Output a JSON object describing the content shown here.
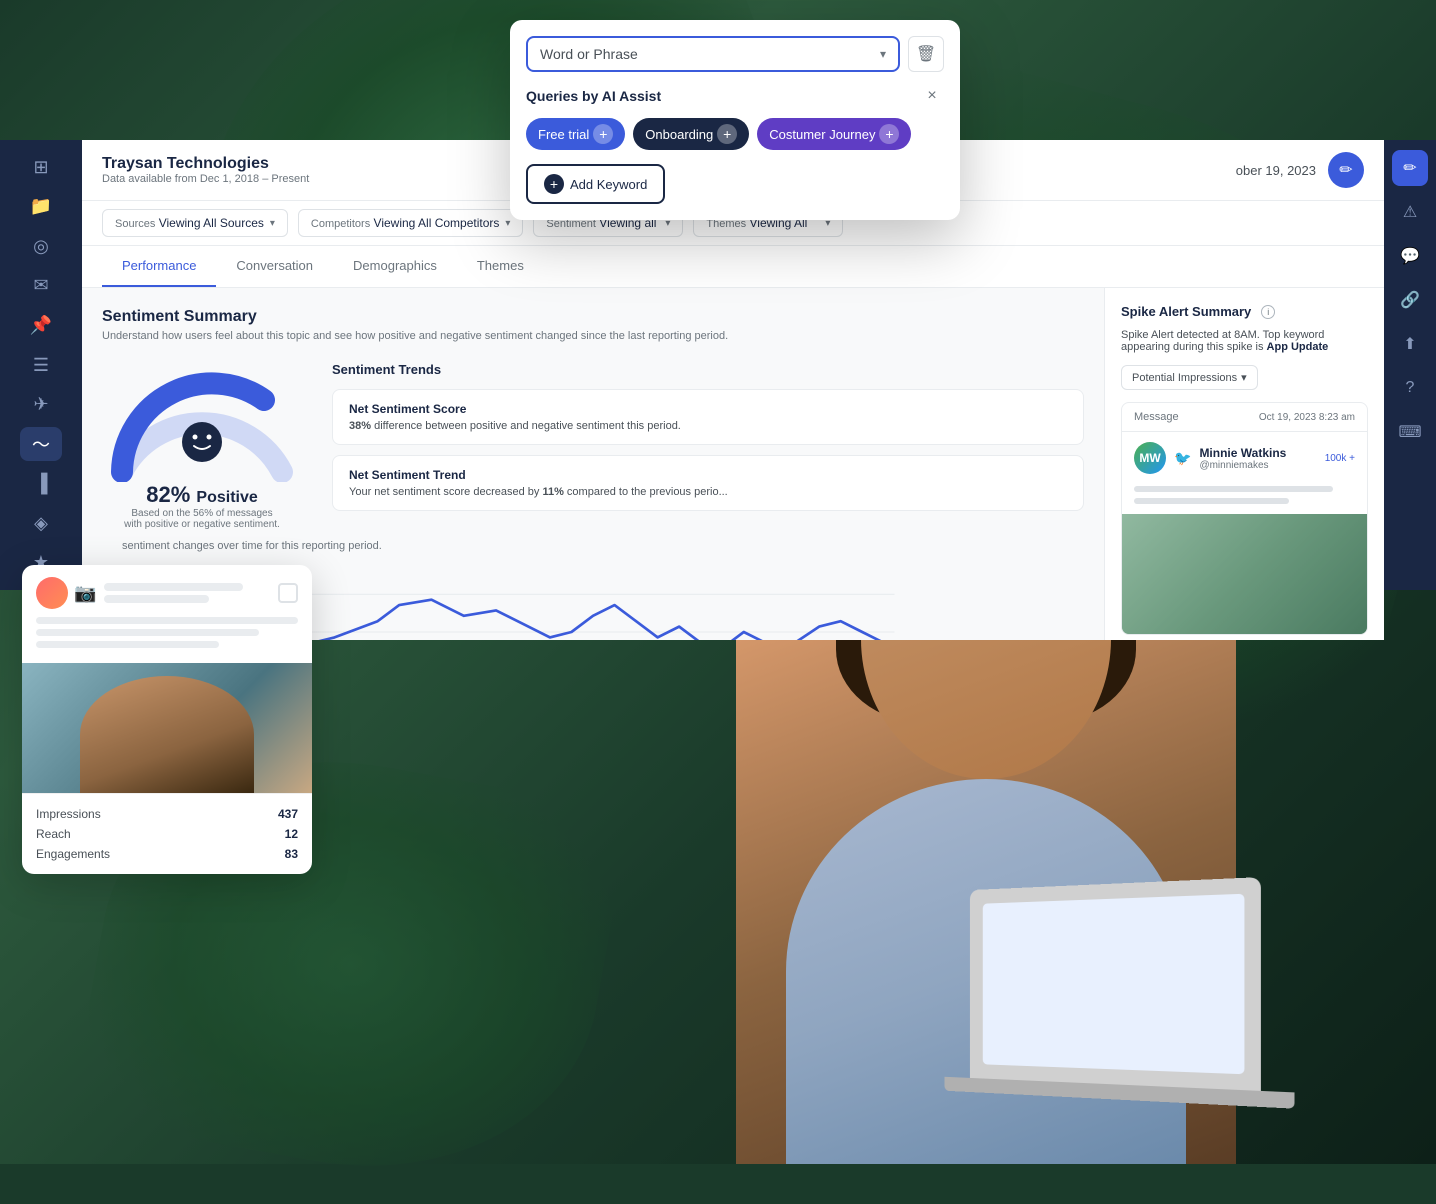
{
  "background": {
    "color": "#1a3a2a"
  },
  "sidebar": {
    "icons": [
      {
        "name": "home-icon",
        "symbol": "⊞",
        "active": false
      },
      {
        "name": "file-icon",
        "symbol": "📁",
        "active": false
      },
      {
        "name": "analytics-icon",
        "symbol": "◎",
        "active": false
      },
      {
        "name": "mail-icon",
        "symbol": "✉",
        "active": false
      },
      {
        "name": "pin-icon",
        "symbol": "📌",
        "active": false
      },
      {
        "name": "list-icon",
        "symbol": "☰",
        "active": false
      },
      {
        "name": "send-icon",
        "symbol": "✈",
        "active": false
      },
      {
        "name": "wave-icon",
        "symbol": "〜",
        "active": true
      },
      {
        "name": "bar-chart-icon",
        "symbol": "▐",
        "active": false
      },
      {
        "name": "badge-icon",
        "symbol": "◈",
        "active": false
      },
      {
        "name": "star-icon",
        "symbol": "★",
        "active": false
      }
    ]
  },
  "right_sidebar": {
    "icons": [
      {
        "name": "edit-icon",
        "symbol": "✏",
        "active": true
      },
      {
        "name": "alert-icon",
        "symbol": "⚠",
        "active": false
      },
      {
        "name": "chat-icon",
        "symbol": "💬",
        "active": false
      },
      {
        "name": "link-icon",
        "symbol": "🔗",
        "active": false
      },
      {
        "name": "upload-icon",
        "symbol": "⬆",
        "active": false
      },
      {
        "name": "help-icon",
        "symbol": "?",
        "active": false
      },
      {
        "name": "keyboard-icon",
        "symbol": "⌨",
        "active": false
      }
    ]
  },
  "header": {
    "company": "Traysan Technologies",
    "data_range": "Data available from Dec 1, 2018 – Present",
    "date": "ober 19, 2023"
  },
  "filters": {
    "sources": {
      "label": "Sources",
      "value": "Viewing All Sources"
    },
    "competitors": {
      "label": "Competitors",
      "value": "Viewing All Competitors"
    },
    "sentiment": {
      "label": "Sentiment",
      "value": "Viewing all"
    },
    "themes": {
      "label": "Themes",
      "value": "Viewing All"
    }
  },
  "tabs": [
    {
      "label": "Performance",
      "active": true
    },
    {
      "label": "Conversation",
      "active": false
    },
    {
      "label": "Demographics",
      "active": false
    },
    {
      "label": "Themes",
      "active": false
    }
  ],
  "sentiment_summary": {
    "title": "Sentiment Summary",
    "description": "Understand how users feel about this topic and see how positive and negative sentiment changed since the last reporting period.",
    "percentage": "82%",
    "percentage_label": "Positive",
    "gauge_sublabel": "Based on the 56% of messages with positive or negative sentiment.",
    "trends_title": "Sentiment Trends",
    "net_score": {
      "title": "Net Sentiment Score",
      "description": "difference between positive and negative sentiment this period.",
      "bold_value": "38%"
    },
    "net_trend": {
      "title": "Net Sentiment Trend",
      "description_prefix": "Your net sentiment score decreased by",
      "bold_value": "11%",
      "description_suffix": "compared to the previous perio..."
    },
    "line_chart_desc": "sentiment changes over time for this reporting period."
  },
  "spike_alert": {
    "title": "Spike Alert Summary",
    "description_prefix": "Spike Alert detected at 8AM. Top keyword appearing during this spike is",
    "keyword": "App Update",
    "dropdown": "Potential Impressions",
    "message": {
      "label": "Message",
      "date": "Oct 19, 2023 8:23 am",
      "user": "Minnie Watkins",
      "handle": "@minniemakes",
      "followers": "100k +"
    }
  },
  "keyword_dialog": {
    "input_placeholder": "Word or Phrase",
    "queries_title": "Queries by AI Assist",
    "tags": [
      {
        "label": "Free trial",
        "color": "blue"
      },
      {
        "label": "Onboarding",
        "color": "dark"
      },
      {
        "label": "Costumer Journey",
        "color": "purple"
      }
    ],
    "add_keyword_label": "Add Keyword",
    "close_symbol": "×"
  },
  "social_card": {
    "platform": "instagram",
    "stats": [
      {
        "label": "Impressions",
        "value": "437"
      },
      {
        "label": "Reach",
        "value": "12"
      },
      {
        "label": "Engagements",
        "value": "83"
      }
    ]
  }
}
